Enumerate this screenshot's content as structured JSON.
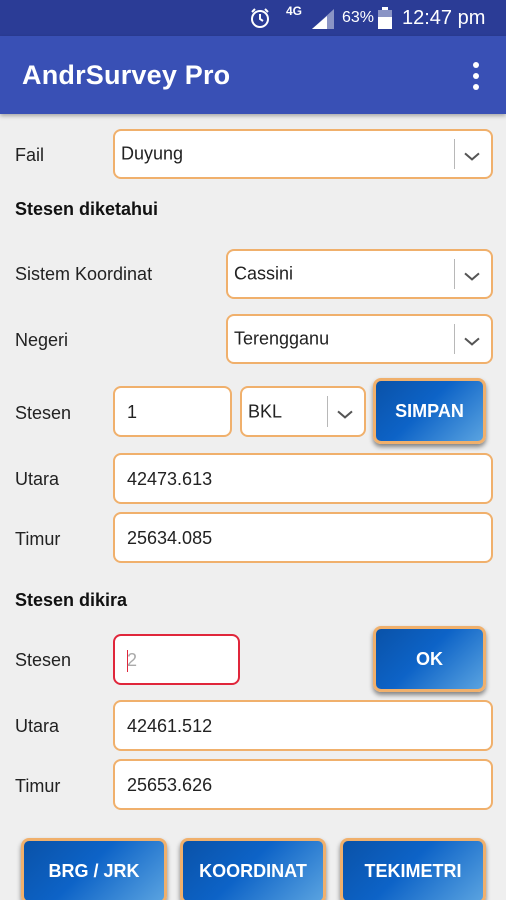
{
  "status": {
    "network": "4G",
    "battery": "63%",
    "time": "12:47 pm"
  },
  "app": {
    "title": "AndrSurvey Pro"
  },
  "fail": {
    "label": "Fail",
    "value": "Duyung"
  },
  "known": {
    "heading": "Stesen diketahui",
    "system_label": "Sistem Koordinat",
    "system_value": "Cassini",
    "state_label": "Negeri",
    "state_value": "Terengganu",
    "station_label": "Stesen",
    "station_value": "1",
    "station_type": "BKL",
    "save_label": "SIMPAN",
    "north_label": "Utara",
    "north_value": "42473.613",
    "east_label": "Timur",
    "east_value": "25634.085"
  },
  "computed": {
    "heading": "Stesen dikira",
    "station_label": "Stesen",
    "station_placeholder": "2",
    "ok_label": "OK",
    "north_label": "Utara",
    "north_value": "42461.512",
    "east_label": "Timur",
    "east_value": "25653.626"
  },
  "actions": {
    "brg_label": "BRG / JRK",
    "coord_label": "KOORDINAT",
    "tachy_label": "TEKIMETRI"
  },
  "colors": {
    "statusbar": "#2b3c96",
    "appbar": "#3950b5",
    "field_border": "#f0b06c",
    "error_border": "#e0263b",
    "button": "#0d63c7"
  },
  "icons": {
    "alarm": "alarm-icon",
    "signal": "signal-icon",
    "battery": "battery-icon",
    "menu": "overflow-menu-icon",
    "dropdown": "chevron-down-icon"
  }
}
